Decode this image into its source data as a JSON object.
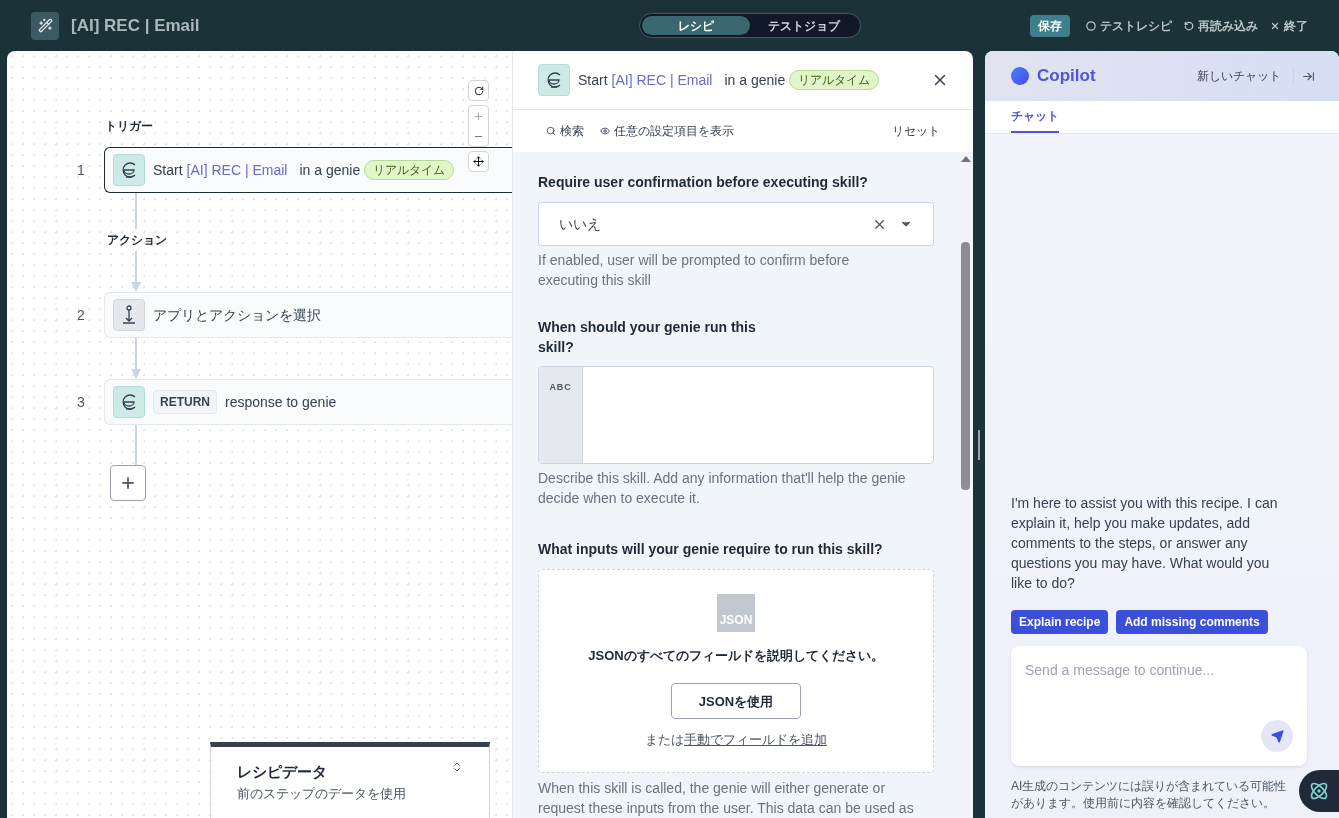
{
  "header": {
    "title": "[AI] REC | Email",
    "tabs": [
      {
        "label": "レシピ",
        "selected": true
      },
      {
        "label": "テストジョブ",
        "selected": false
      }
    ],
    "actions": [
      {
        "kind": "save",
        "label": "保存"
      },
      {
        "kind": "test",
        "label": "テストレシピ"
      },
      {
        "kind": "reload",
        "label": "再読み込み"
      },
      {
        "kind": "exit",
        "label": "終了"
      }
    ]
  },
  "canvas": {
    "trigger_label": "トリガー",
    "action_label": "アクション",
    "steps": [
      {
        "number": "1",
        "kind": "trigger",
        "selected": true,
        "prefix": "Start",
        "name": "[AI] REC | Email",
        "suffix": "in a genie",
        "badge": "リアルタイム"
      },
      {
        "number": "2",
        "kind": "pick",
        "selected": false,
        "text": "アプリとアクションを選択"
      },
      {
        "number": "3",
        "kind": "return",
        "selected": false,
        "tag": "RETURN",
        "text": "response to genie"
      }
    ],
    "recipe_data": {
      "title": "レシピデータ",
      "subtitle": "前のステップのデータを使用"
    }
  },
  "panel": {
    "header": {
      "prefix": "Start",
      "name": "[AI] REC | Email",
      "suffix": "in a genie",
      "badge": "リアルタイム"
    },
    "toolbar": {
      "search": "検索",
      "optional": "任意の設定項目を表示",
      "reset": "リセット"
    },
    "confirm": {
      "label": "Require user confirmation before executing skill?",
      "value": "いいえ",
      "hint": "If enabled, user will be prompted to confirm before executing this skill"
    },
    "when": {
      "label": "When should your genie run this skill?",
      "type_tag": "ABC",
      "hint": "Describe this skill. Add any information that'll help the genie decide when to execute it."
    },
    "inputs": {
      "label": "What inputs will your genie require to run this skill?",
      "json_tag": "JSON",
      "prompt": "JSONのすべてのフィールドを説明してください。",
      "button": "JSONを使用",
      "or_text": "または",
      "manual_link": "手動でフィールドを追加",
      "hint": "When this skill is called, the genie will either generate or request these inputs from the user. This data can be used as"
    }
  },
  "copilot": {
    "title": "Copilot",
    "new_chat": "新しいチャット",
    "tabs": [
      {
        "label": "チャット",
        "selected": true
      }
    ],
    "message": "I'm here to assist you with this recipe. I can explain it, help you make updates, add comments to the steps, or answer any questions you may have. What would you like to do?",
    "suggestions": [
      "Explain recipe",
      "Add missing comments"
    ],
    "input": {
      "placeholder": "Send a message to continue..."
    },
    "disclaimer": "AI生成のコンテンツには誤りが含まれている可能性があります。使用前に内容を確認してください。"
  }
}
